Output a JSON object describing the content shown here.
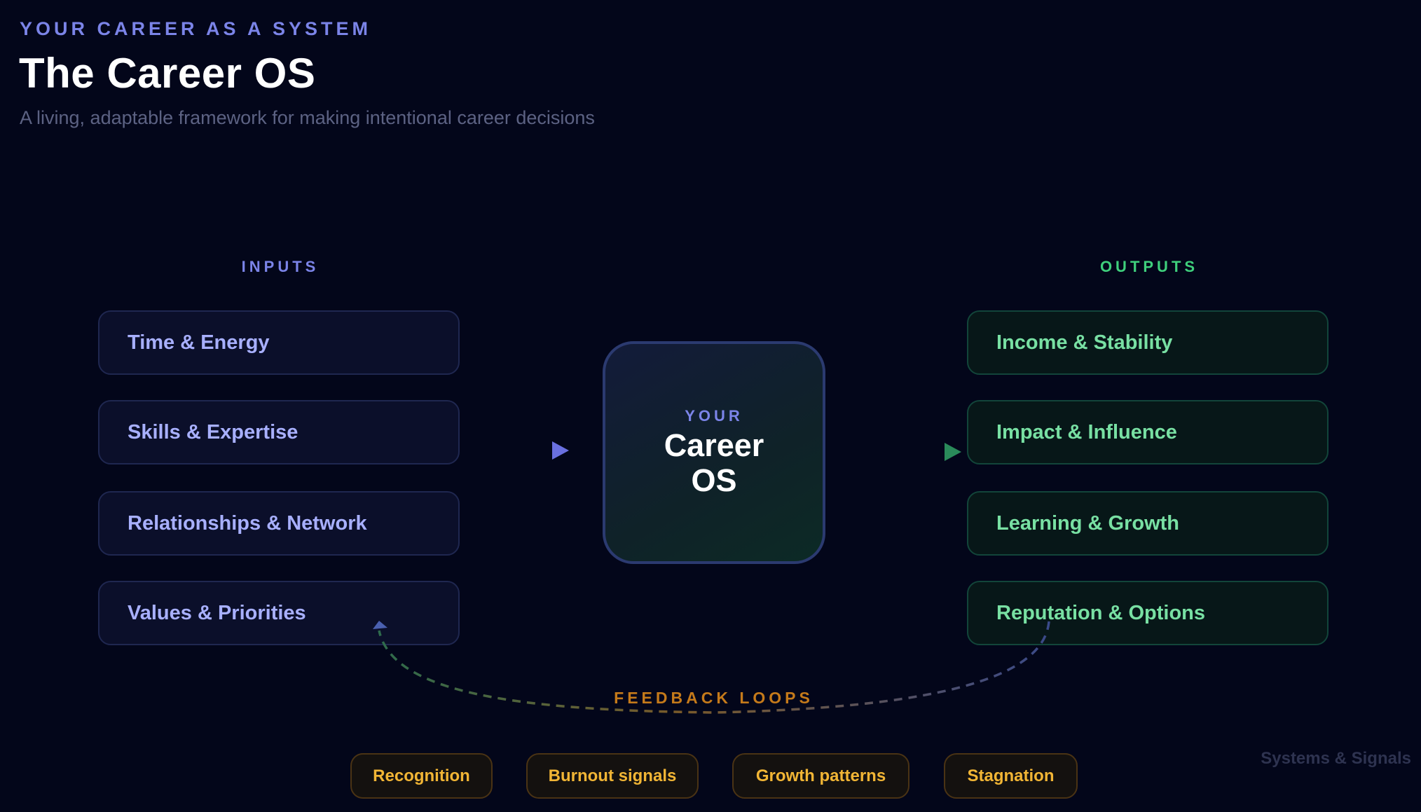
{
  "header": {
    "eyebrow": "YOUR CAREER AS A SYSTEM",
    "title": "The Career OS",
    "subtitle": "A living, adaptable framework for making intentional career decisions"
  },
  "inputs": {
    "label": "INPUTS",
    "items": [
      {
        "label": "Time & Energy"
      },
      {
        "label": "Skills & Expertise"
      },
      {
        "label": "Relationships & Network"
      },
      {
        "label": "Values & Priorities"
      }
    ]
  },
  "core": {
    "kicker": "YOUR",
    "title": "Career OS"
  },
  "outputs": {
    "label": "OUTPUTS",
    "items": [
      {
        "label": "Income & Stability"
      },
      {
        "label": "Impact & Influence"
      },
      {
        "label": "Learning & Growth"
      },
      {
        "label": "Reputation & Options"
      }
    ]
  },
  "feedback": {
    "label": "FEEDBACK LOOPS",
    "chips": [
      {
        "label": "Recognition"
      },
      {
        "label": "Burnout signals"
      },
      {
        "label": "Growth patterns"
      },
      {
        "label": "Stagnation"
      }
    ]
  },
  "brand": "Systems & Signals",
  "colors": {
    "background": "#03061a",
    "input_accent": "#7b84e8",
    "output_accent": "#3fcf7c",
    "feedback_accent": "#c57a1a",
    "chip_text": "#f1b535"
  },
  "icons": {
    "input_arrow": "triangle-right",
    "output_arrow": "triangle-right"
  }
}
